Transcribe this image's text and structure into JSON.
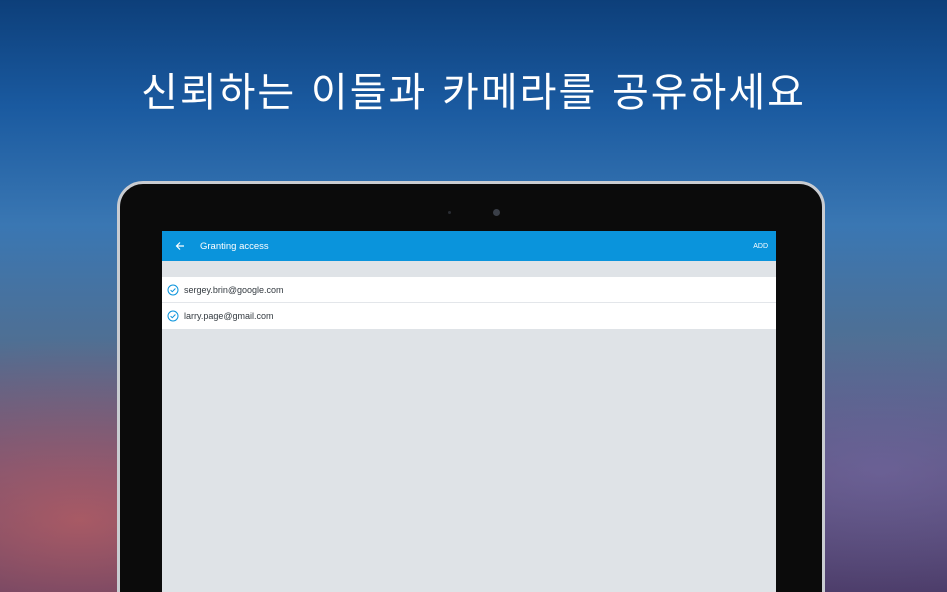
{
  "headline": "신뢰하는 이들과 카메라를 공유하세요",
  "appbar": {
    "back_icon": "arrow-left-icon",
    "title": "Granting access",
    "add_label": "ADD"
  },
  "access_list": [
    {
      "email": "sergey.brin@google.com",
      "icon": "check-circle-icon"
    },
    {
      "email": "larry.page@gmail.com",
      "icon": "check-circle-icon"
    }
  ],
  "colors": {
    "appbar": "#0a94dc",
    "check": "#0a94dc",
    "screen_bg": "#dfe3e7"
  }
}
